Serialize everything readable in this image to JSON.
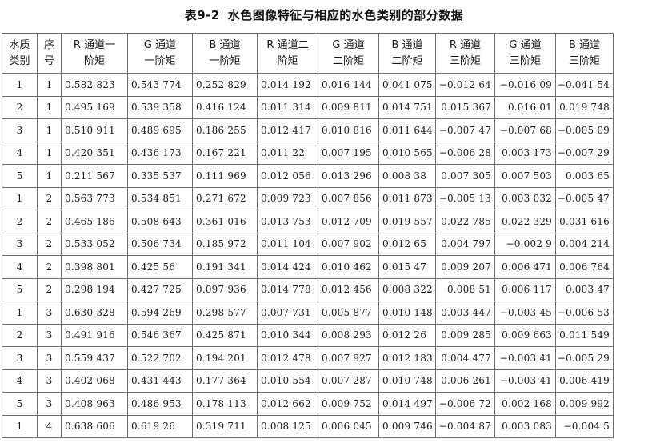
{
  "caption": {
    "number": "表9-2",
    "title": "水色图像特征与相应的水色类别的部分数据"
  },
  "table": {
    "headers": [
      [
        "水质",
        "类别"
      ],
      [
        "序",
        "号"
      ],
      [
        "R 通道一",
        "阶矩"
      ],
      [
        "G 通道",
        "一阶矩"
      ],
      [
        "B 通道",
        "一阶矩"
      ],
      [
        "R 通道二",
        "阶矩"
      ],
      [
        "G 通道",
        "二阶矩"
      ],
      [
        "B 通道",
        "二阶矩"
      ],
      [
        "R 通道",
        "三阶矩"
      ],
      [
        "G 通道",
        "三阶矩"
      ],
      [
        "B 通道",
        "三阶矩"
      ]
    ],
    "rows": [
      [
        "1",
        "1",
        "0.582 823",
        "0.543 774",
        "0.252 829",
        "0.014 192",
        "0.016 144",
        "0.041 075",
        "−0.012 64",
        "−0.016 09",
        "−0.041 54"
      ],
      [
        "2",
        "1",
        "0.495 169",
        "0.539 358",
        "0.416 124",
        "0.011 314",
        "0.009 811",
        "0.014 751",
        "0.015 367",
        "0.016 01",
        "0.019 748"
      ],
      [
        "3",
        "1",
        "0.510 911",
        "0.489 695",
        "0.186 255",
        "0.012 417",
        "0.010 816",
        "0.011 644",
        "−0.007 47",
        "−0.007 68",
        "−0.005 09"
      ],
      [
        "4",
        "1",
        "0.420 351",
        "0.436 173",
        "0.167 221",
        "0.011 22",
        "0.007 195",
        "0.010 565",
        "−0.006 28",
        "0.003 173",
        "−0.007 29"
      ],
      [
        "5",
        "1",
        "0.211 567",
        "0.335 537",
        "0.111 969",
        "0.012 056",
        "0.013 296",
        "0.008 38",
        "0.007 305",
        "0.007 503",
        "0.003 65"
      ],
      [
        "1",
        "2",
        "0.563 773",
        "0.534 851",
        "0.271 672",
        "0.009 723",
        "0.007 856",
        "0.011 873",
        "−0.005 13",
        "0.003 032",
        "−0.005 47"
      ],
      [
        "2",
        "2",
        "0.465 186",
        "0.508 643",
        "0.361 016",
        "0.013 753",
        "0.012 709",
        "0.019 557",
        "0.022 785",
        "0.022 329",
        "0.031 616"
      ],
      [
        "3",
        "2",
        "0.533 052",
        "0.506 734",
        "0.185 972",
        "0.011 104",
        "0.007 902",
        "0.012 65",
        "0.004 797",
        "−0.002 9",
        "0.004 214"
      ],
      [
        "4",
        "2",
        "0.398 801",
        "0.425 56",
        "0.191 341",
        "0.014 424",
        "0.010 462",
        "0.015 47",
        "0.009 207",
        "0.006 471",
        "0.006 764"
      ],
      [
        "5",
        "2",
        "0.298 194",
        "0.427 725",
        "0.097 936",
        "0.014 778",
        "0.012 456",
        "0.008 322",
        "0.008 51",
        "0.006 117",
        "0.003 47"
      ],
      [
        "1",
        "3",
        "0.630 328",
        "0.594 269",
        "0.298 577",
        "0.007 731",
        "0.005 877",
        "0.010 148",
        "0.003 447",
        "−0.003 45",
        "−0.006 53"
      ],
      [
        "2",
        "3",
        "0.491 916",
        "0.546 367",
        "0.425 871",
        "0.010 344",
        "0.008 293",
        "0.012 26",
        "0.009 285",
        "0.009 663",
        "0.011 549"
      ],
      [
        "3",
        "3",
        "0.559 437",
        "0.522 702",
        "0.194 201",
        "0.012 478",
        "0.007 927",
        "0.012 183",
        "0.004 477",
        "−0.003 41",
        "−0.005 29"
      ],
      [
        "4",
        "3",
        "0.402 068",
        "0.431 443",
        "0.177 364",
        "0.010 554",
        "0.007 287",
        "0.010 748",
        "0.006 261",
        "−0.003 41",
        "0.006 419"
      ],
      [
        "5",
        "3",
        "0.408 963",
        "0.486 953",
        "0.178 113",
        "0.012 662",
        "0.009 752",
        "0.014 497",
        "−0.006 72",
        "0.002 168",
        "0.009 992"
      ],
      [
        "1",
        "4",
        "0.638 606",
        "0.619 26",
        "0.319 711",
        "0.008 125",
        "0.006 045",
        "0.009 746",
        "−0.004 87",
        "0.003 083",
        "−0.004 5"
      ]
    ]
  }
}
